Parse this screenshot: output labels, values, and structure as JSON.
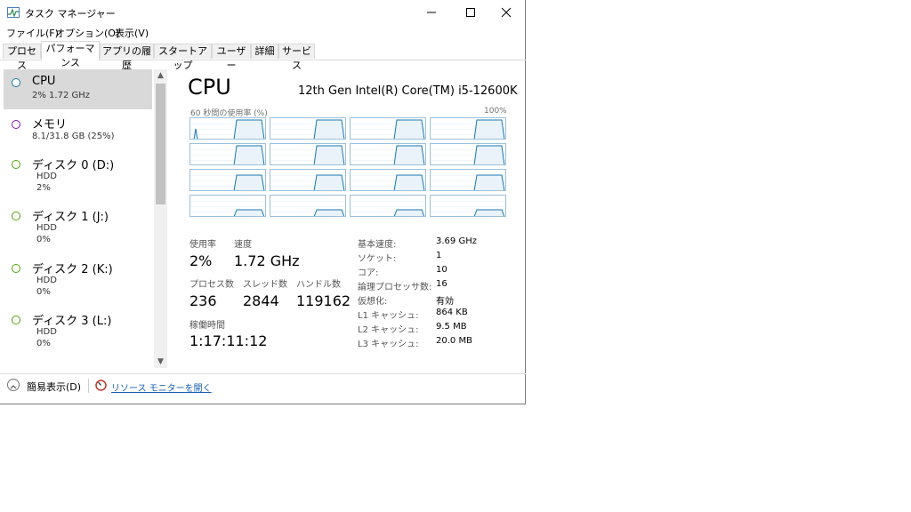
{
  "window": {
    "title": "タスク マネージャー",
    "minimize_glyph": "—",
    "maximize_glyph": "☐",
    "close_glyph": "✕"
  },
  "menu": [
    "ファイル(F)",
    "オプション(O)",
    "表示(V)"
  ],
  "tabs": [
    "プロセス",
    "パフォーマンス",
    "アプリの履歴",
    "スタートアップ",
    "ユーザー",
    "詳細",
    "サービス"
  ],
  "active_tab": "パフォーマンス",
  "sidebar": {
    "items": [
      {
        "name": "CPU",
        "line2": "2%  1.72 GHz",
        "line3": "",
        "dot_color": "#1778b0",
        "selected": true
      },
      {
        "name": "メモリ",
        "line2": "8.1/31.8 GB (25%)",
        "line3": "",
        "dot_color": "#8b12ae",
        "selected": false
      },
      {
        "name": "ディスク 0 (D:)",
        "line2": "HDD",
        "line3": "2%",
        "dot_color": "#4da60c",
        "selected": false
      },
      {
        "name": "ディスク 1 (J:)",
        "line2": "HDD",
        "line3": "0%",
        "dot_color": "#4da60c",
        "selected": false
      },
      {
        "name": "ディスク 2 (K:)",
        "line2": "HDD",
        "line3": "0%",
        "dot_color": "#4da60c",
        "selected": false
      },
      {
        "name": "ディスク 3 (L:)",
        "line2": "HDD",
        "line3": "0%",
        "dot_color": "#4da60c",
        "selected": false
      }
    ]
  },
  "main": {
    "title": "CPU",
    "model": "12th Gen Intel(R) Core(TM) i5-12600K",
    "graph_label": "60 秒間の使用率 (%)",
    "graph_max": "100%",
    "graph_color": "#1778b0",
    "usage": {
      "label": "使用率",
      "value": "2%"
    },
    "speed": {
      "label": "速度",
      "value": "1.72 GHz"
    },
    "processes": {
      "label": "プロセス数",
      "value": "236"
    },
    "threads": {
      "label": "スレッド数",
      "value": "2844"
    },
    "handles": {
      "label": "ハンドル数",
      "value": "119162"
    },
    "uptime": {
      "label": "稼働時間",
      "value": "1:17:11:12"
    },
    "details": [
      {
        "label": "基本速度:",
        "value": "3.69 GHz"
      },
      {
        "label": "ソケット:",
        "value": "1"
      },
      {
        "label": "コア:",
        "value": "10"
      },
      {
        "label": "論理プロセッサ数:",
        "value": "16"
      },
      {
        "label": "仮想化:",
        "value": "有効"
      },
      {
        "label": "L1 キャッシュ:",
        "value": "864 KB"
      },
      {
        "label": "L2 キャッシュ:",
        "value": "9.5 MB"
      },
      {
        "label": "L3 キャッシュ:",
        "value": "20.0 MB"
      }
    ]
  },
  "footer": {
    "fewer_details": "簡易表示(D)",
    "resource_monitor": "リソース モニターを開く"
  }
}
